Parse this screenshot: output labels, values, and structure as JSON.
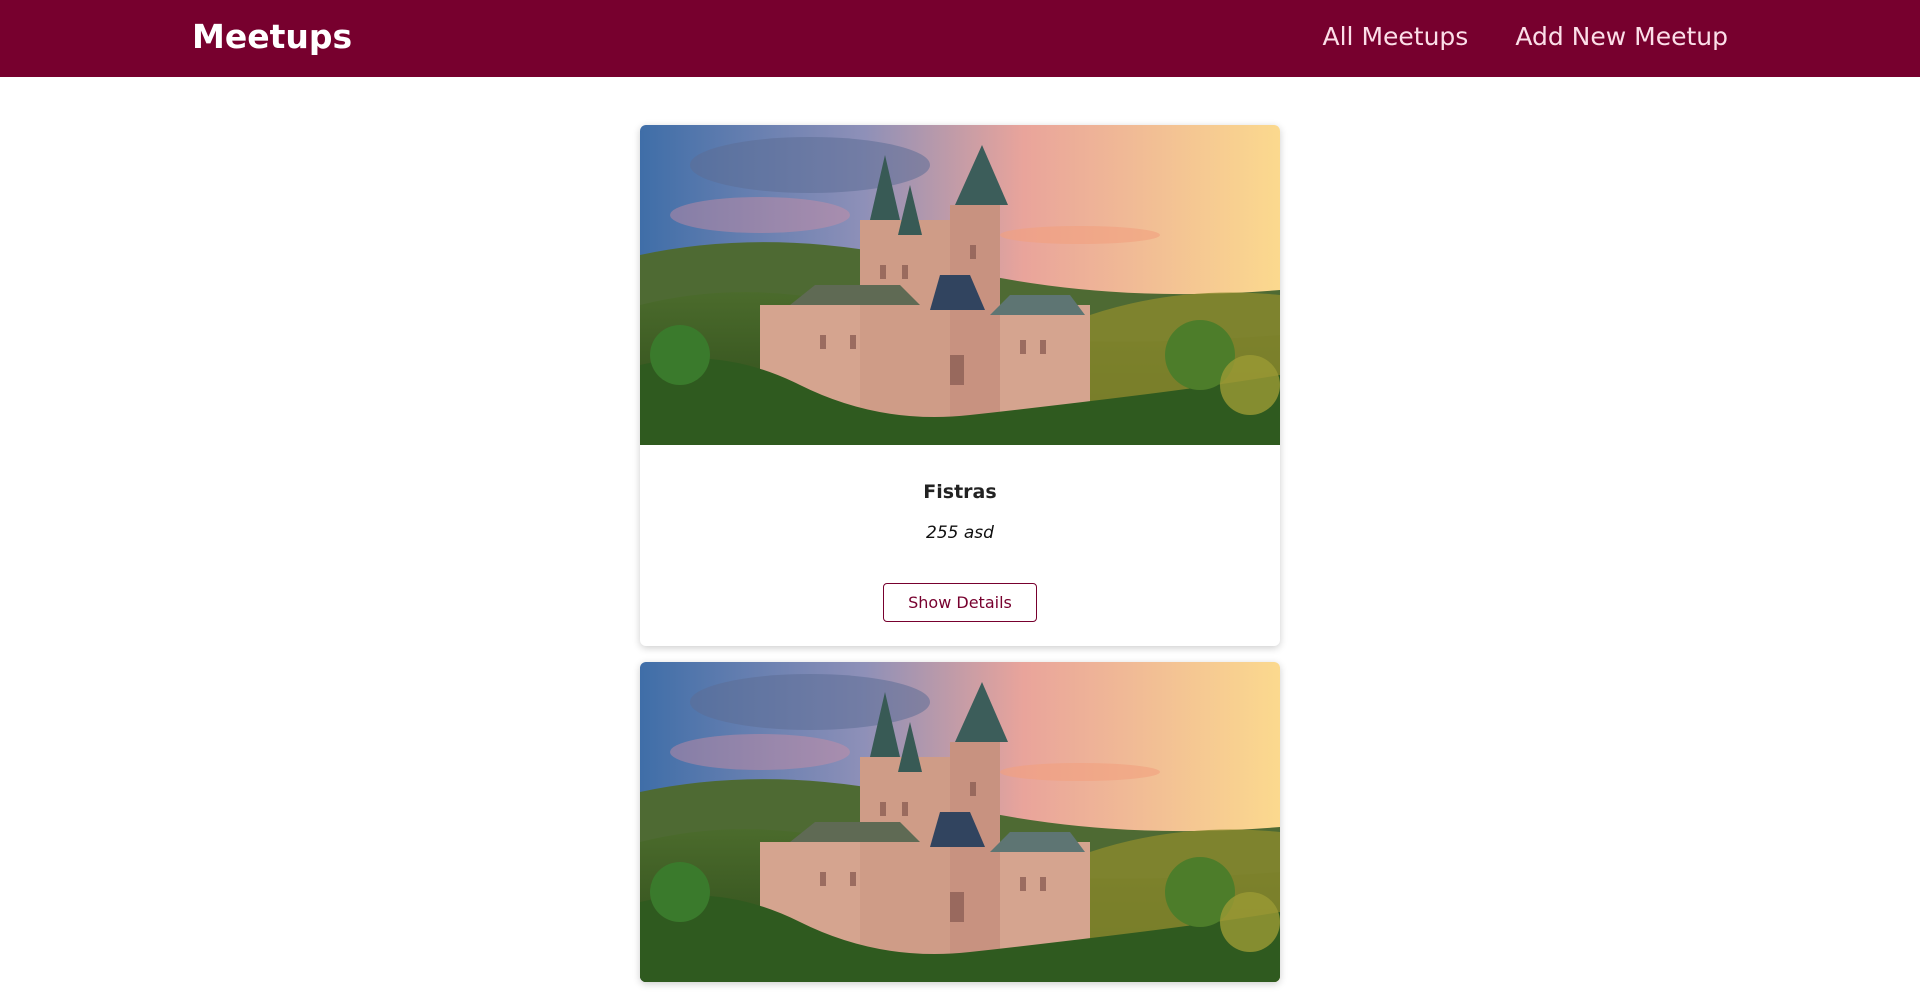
{
  "header": {
    "logo": "Meetups",
    "nav": [
      "All Meetups",
      "Add New Meetup"
    ]
  },
  "meetups": [
    {
      "title": "Fistras",
      "address": "255 asd",
      "action": "Show Details",
      "image_alt": "castle-on-hill-photo"
    },
    {
      "title": "",
      "address": "",
      "action": "",
      "image_alt": "castle-on-hill-photo"
    }
  ],
  "colors": {
    "brand": "#77002e",
    "nav_link": "#fcdee8"
  }
}
